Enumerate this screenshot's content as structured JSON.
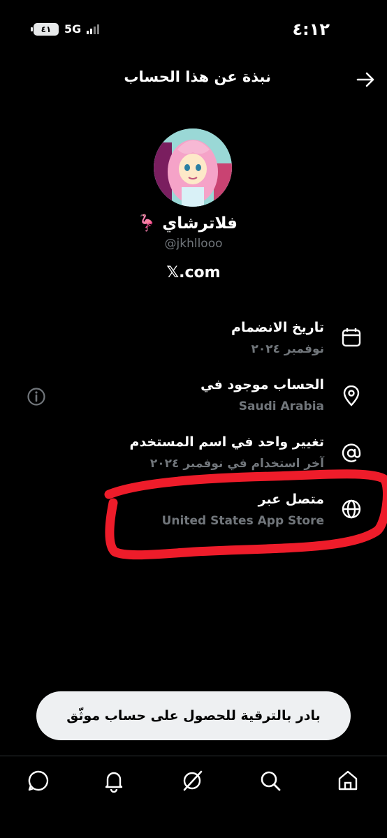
{
  "status_bar": {
    "time": "٤:١٢",
    "battery": "٤١",
    "network": "5G"
  },
  "header": {
    "title": "نبذة عن هذا الحساب",
    "back_icon": "arrow-right-icon"
  },
  "profile": {
    "display_name": "فلاترشاي 🦩",
    "handle": "@jkhllooo",
    "site": "𝕏.com"
  },
  "rows": [
    {
      "icon": "calendar-icon",
      "title": "تاريخ الانضمام",
      "value": "نوفمبر ٢٠٢٤"
    },
    {
      "icon": "location-pin-icon",
      "title": "الحساب موجود في",
      "value": "Saudi Arabia",
      "extra_icon": "info-icon"
    },
    {
      "icon": "at-sign-icon",
      "title": "تغيير واحد في اسم المستخدم",
      "value": "آخر استخدام في نوفمبر ٢٠٢٤"
    },
    {
      "icon": "globe-icon",
      "title": "متصل عبر",
      "value": "United States App Store"
    }
  ],
  "upgrade_button": {
    "label": "بادر بالترقية للحصول على حساب موثّق"
  },
  "bottom_nav": [
    "messages-icon",
    "notifications-icon",
    "grok-icon",
    "search-icon",
    "home-icon"
  ],
  "colors": {
    "background": "#000000",
    "primary_text": "#ffffff",
    "secondary_text": "#71767b",
    "annotation_red": "#ee1c2a",
    "button_bg": "#eef0f2"
  }
}
